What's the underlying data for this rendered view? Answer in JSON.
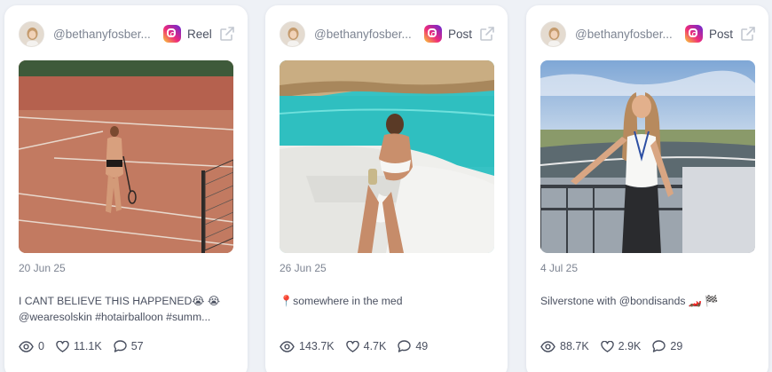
{
  "colors": {
    "background": "#eef1f6",
    "card": "#ffffff",
    "muted_text": "#7d8492",
    "body_text": "#4a5060"
  },
  "posts": [
    {
      "handle": "@bethanyfosber...",
      "platform_icon": "instagram-icon",
      "type": "Reel",
      "date": "20 Jun 25",
      "caption_line1": "I CANT BELIEVE THIS HAPPENED😭 😭",
      "caption_line2": "@wearesolskin #hotairballoon #summ...",
      "views": "0",
      "likes": "11.1K",
      "comments": "57"
    },
    {
      "handle": "@bethanyfosber...",
      "platform_icon": "instagram-icon",
      "type": "Post",
      "date": "26 Jun 25",
      "caption_line1": "📍somewhere in the med",
      "caption_line2": "",
      "views": "143.7K",
      "likes": "4.7K",
      "comments": "49"
    },
    {
      "handle": "@bethanyfosber...",
      "platform_icon": "instagram-icon",
      "type": "Post",
      "date": "4 Jul 25",
      "caption_line1": "Silverstone with @bondisands 🏎️ 🏁",
      "caption_line2": "",
      "views": "88.7K",
      "likes": "2.9K",
      "comments": "29"
    }
  ]
}
